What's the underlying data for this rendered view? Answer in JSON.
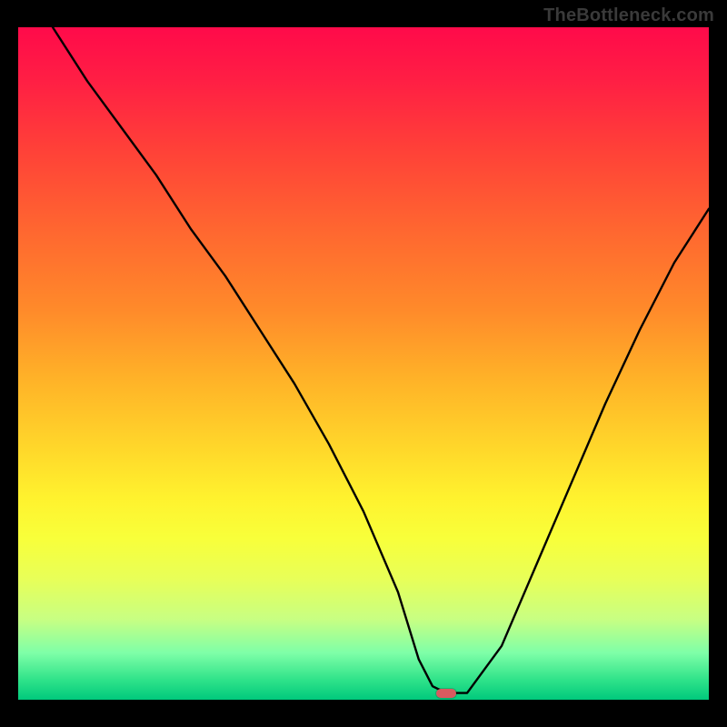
{
  "watermark": "TheBottleneck.com",
  "chart_data": {
    "type": "line",
    "title": "",
    "xlabel": "",
    "ylabel": "",
    "xlim": [
      0,
      100
    ],
    "ylim": [
      0,
      100
    ],
    "grid": false,
    "legend": false,
    "background": {
      "type": "vertical_gradient",
      "stops": [
        {
          "pos": 0,
          "color": "#ff0a4a"
        },
        {
          "pos": 30,
          "color": "#ff6630"
        },
        {
          "pos": 62,
          "color": "#ffd52a"
        },
        {
          "pos": 82,
          "color": "#e8ff58"
        },
        {
          "pos": 100,
          "color": "#00c97c"
        }
      ]
    },
    "series": [
      {
        "name": "bottleneck-curve",
        "color": "#000000",
        "x": [
          5,
          10,
          15,
          20,
          25,
          30,
          35,
          40,
          45,
          50,
          55,
          58,
          60,
          62,
          65,
          70,
          75,
          80,
          85,
          90,
          95,
          100
        ],
        "y": [
          100,
          92,
          85,
          78,
          70,
          63,
          55,
          47,
          38,
          28,
          16,
          6,
          2,
          1,
          1,
          8,
          20,
          32,
          44,
          55,
          65,
          73
        ]
      }
    ],
    "marker": {
      "x": 62,
      "y": 1,
      "color": "#d85a60",
      "shape": "rounded-rect"
    }
  }
}
